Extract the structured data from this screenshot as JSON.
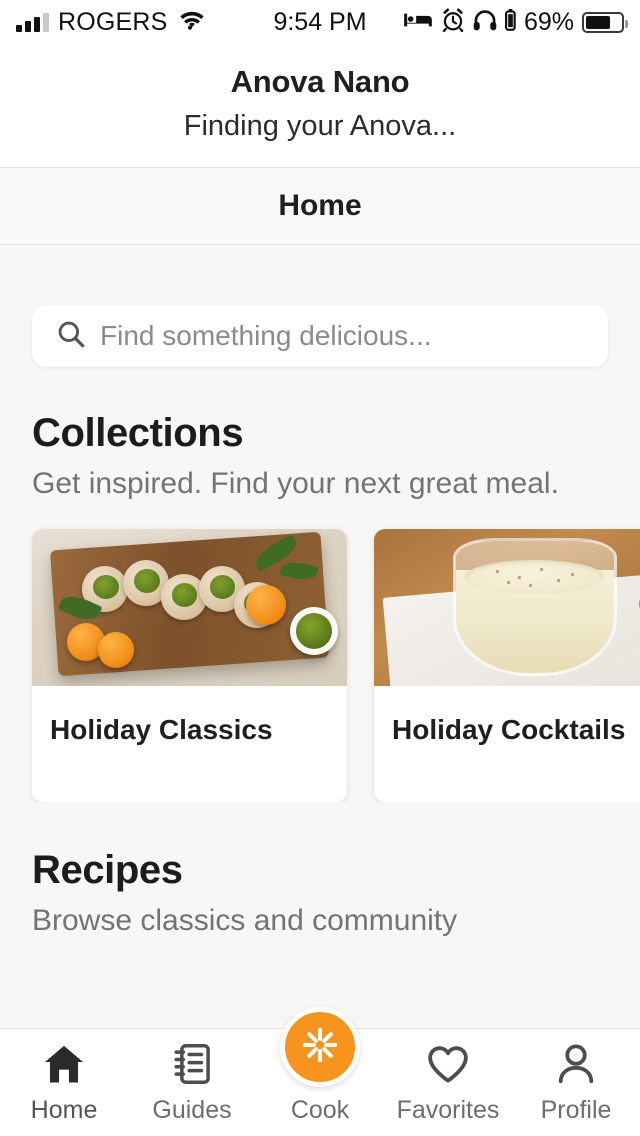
{
  "status_bar": {
    "carrier": "ROGERS",
    "time": "9:54 PM",
    "battery_percent": "69%",
    "icons": [
      "signal-bars-icon",
      "wifi-icon",
      "bed-icon",
      "alarm-clock-icon",
      "headphones-icon",
      "headphone-battery-icon",
      "battery-icon"
    ]
  },
  "device_header": {
    "title": "Anova Nano",
    "status": "Finding your Anova..."
  },
  "navbar": {
    "title": "Home"
  },
  "search": {
    "placeholder": "Find something delicious...",
    "value": "",
    "icon": "search-icon"
  },
  "collections": {
    "title": "Collections",
    "subtitle": "Get inspired. Find your next great meal.",
    "cards": [
      {
        "label": "Holiday Classics",
        "image": "pork-roulade-on-wooden-board-with-oranges-and-chimichurri"
      },
      {
        "label": "Holiday Cocktails",
        "image": "eggnog-in-glass-with-nutmeg-on-napkins"
      }
    ]
  },
  "recipes": {
    "title": "Recipes",
    "subtitle": "Browse classics and community"
  },
  "tabbar": {
    "items": [
      {
        "label": "Home",
        "icon": "home-icon",
        "active": true
      },
      {
        "label": "Guides",
        "icon": "notebook-icon",
        "active": false
      },
      {
        "label": "Cook",
        "icon": "anova-burst-icon",
        "active": false
      },
      {
        "label": "Favorites",
        "icon": "heart-icon",
        "active": false
      },
      {
        "label": "Profile",
        "icon": "person-icon",
        "active": false
      }
    ]
  },
  "colors": {
    "accent": "#f7941d",
    "background": "#f8f7f6",
    "card": "#ffffff",
    "text_primary": "#1f1f1f",
    "text_secondary": "#737373"
  }
}
